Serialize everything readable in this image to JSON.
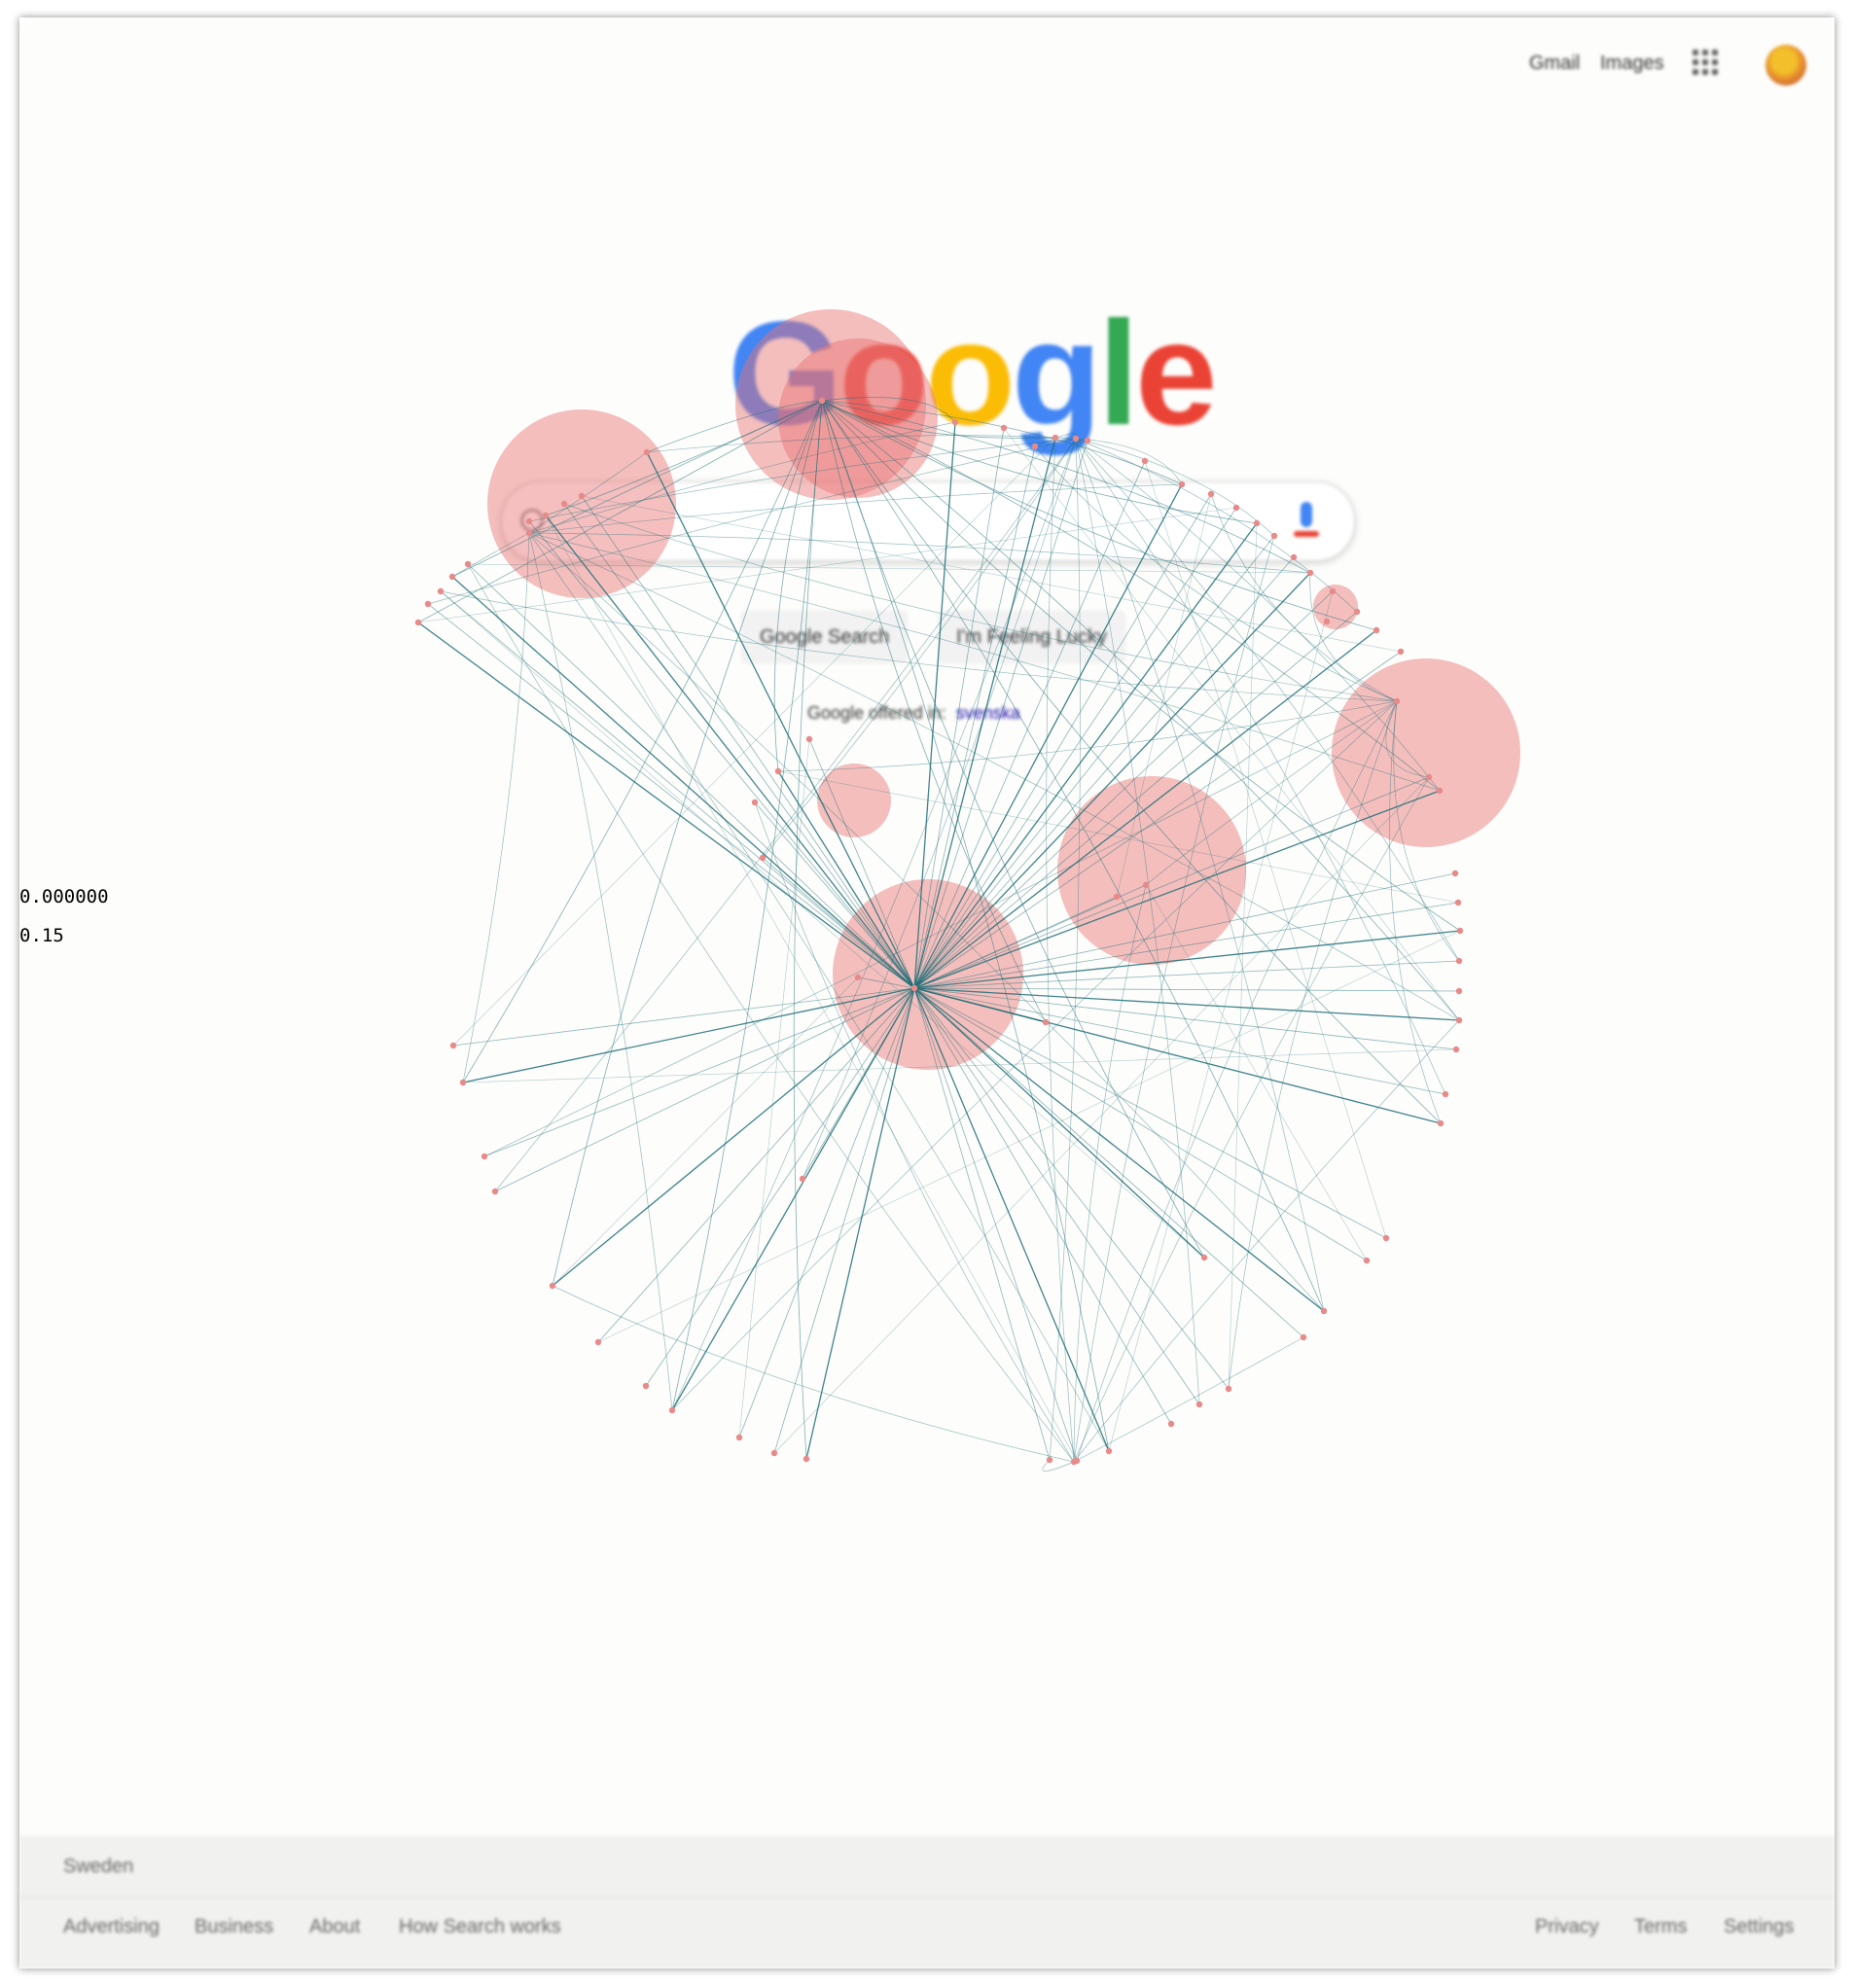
{
  "header": {
    "gmail_label": "Gmail",
    "images_label": "Images"
  },
  "logo": [
    "G",
    "o",
    "o",
    "g",
    "l",
    "e"
  ],
  "logo_colors": [
    "#4285f4",
    "#ea4335",
    "#fbbc05",
    "#4285f4",
    "#34a853",
    "#ea4335"
  ],
  "buttons": {
    "search_label": "Google Search",
    "lucky_label": "I'm Feeling Lucky"
  },
  "offered": {
    "prefix": "Google offered in:",
    "language": "svenska"
  },
  "footer": {
    "country": "Sweden",
    "left_links": [
      "Advertising",
      "Business",
      "About",
      "How Search works"
    ],
    "right_links": [
      "Privacy",
      "Terms",
      "Settings"
    ]
  },
  "readouts": {
    "value_1": "0.000000",
    "value_2": "0.15"
  },
  "colors": {
    "edge": "#1f6f78",
    "node": "#e88a8a",
    "bubble": "rgba(233,113,113,0.45)"
  }
}
